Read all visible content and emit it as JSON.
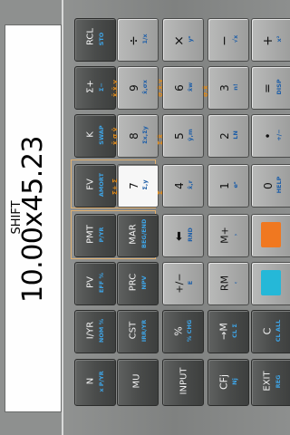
{
  "display": {
    "value": "10.00x45.23",
    "mode": "SHIFT"
  },
  "keys": {
    "rcl": {
      "label": "RCL",
      "sub": "STO"
    },
    "div": {
      "label": "÷",
      "sub": "1/x"
    },
    "mul": {
      "label": "×",
      "sub": "yˣ"
    },
    "minus": {
      "label": "−",
      "sub": "√x"
    },
    "plus": {
      "label": "+",
      "sub": "x²"
    },
    "sigma": {
      "label": "Σ+",
      "sub": "Σ−",
      "gold": "x̄,x̄,y"
    },
    "nine": {
      "label": "9",
      "sub": "x̂,σx",
      "gold": "σ,x̄,y"
    },
    "six": {
      "label": "6",
      "sub": "x̄w",
      "gold": "σ,x̄"
    },
    "three": {
      "label": "3",
      "sub": "n!"
    },
    "equals": {
      "label": "=",
      "sub": "DISP"
    },
    "k": {
      "label": "K",
      "sub": "SWAP",
      "gold": "x̄ σ ŷ"
    },
    "eight": {
      "label": "8",
      "sub": "Σx,Σy",
      "gold": "Σ x̄"
    },
    "five": {
      "label": "5",
      "sub": "ŷ,m"
    },
    "two": {
      "label": "2",
      "sub": "LN"
    },
    "dot": {
      "label": "•",
      "sub": "+/−"
    },
    "fv": {
      "label": "FV",
      "sub": "AMORT",
      "gold": "Σ+ Σ"
    },
    "seven": {
      "label": "7",
      "sub": "Σ,y"
    },
    "four": {
      "label": "4",
      "sub": "x̂,r",
      "gold": "Σ"
    },
    "one": {
      "label": "1",
      "sub": "eˣ"
    },
    "zero": {
      "label": "0",
      "sub": "HELP"
    },
    "pmt": {
      "label": "PMT",
      "sub": "P/YR"
    },
    "mar": {
      "label": "MAR",
      "sub": "BEG/END"
    },
    "rnd": {
      "label": "⬅",
      "sub": "RND"
    },
    "mplus": {
      "label": "M+",
      "sub": "›"
    },
    "pv": {
      "label": "PV",
      "sub": "EFF %"
    },
    "prc": {
      "label": "PRC",
      "sub": "NPV"
    },
    "chs": {
      "label": "+/−",
      "sub": "E"
    },
    "rm": {
      "label": "RM",
      "sub": "‹"
    },
    "iyr": {
      "label": "I/YR",
      "sub": "NOM %"
    },
    "cst": {
      "label": "CST",
      "sub": "IRR/YR"
    },
    "pct": {
      "label": "%",
      "sub": "% CHG"
    },
    "tom": {
      "label": "→M",
      "sub": "CL Σ"
    },
    "c": {
      "label": "C",
      "sub": "CL ALL"
    },
    "n": {
      "label": "N",
      "sub": "x P/YR"
    },
    "mu": {
      "label": "MU",
      "sub": ""
    },
    "input": {
      "label": "INPUT",
      "sub": ""
    },
    "cfj": {
      "label": "CFj",
      "sub": "Nj"
    },
    "exit": {
      "label": "EXIT",
      "sub": "REG"
    }
  },
  "colors": {
    "shift_orange": "#f07820",
    "shift_blue": "#25b8d8",
    "gold_text": "#e08a1a",
    "blue_text": "#3ea4e6"
  }
}
